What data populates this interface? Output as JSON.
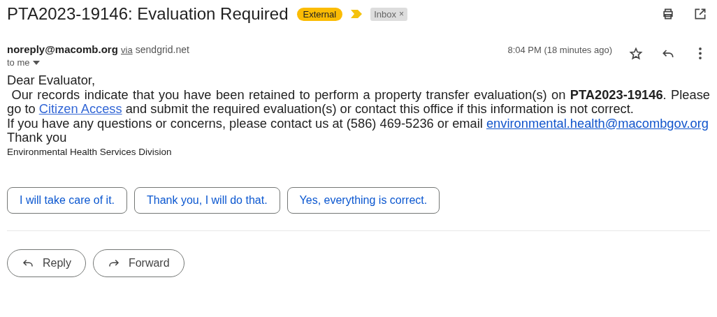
{
  "subject": "PTA2023-19146: Evaluation Required",
  "labels": [
    {
      "kind": "external",
      "text": "External"
    },
    {
      "kind": "importance"
    },
    {
      "kind": "inbox",
      "text": "Inbox",
      "close": "×"
    }
  ],
  "sender": {
    "address": "noreply@macomb.org",
    "via": "via",
    "relay": "sendgrid.net",
    "recipient": "to me"
  },
  "time": "8:04 PM (18 minutes ago)",
  "starred": false,
  "body": [
    {
      "kind": "plain",
      "text": "Dear Evaluator,"
    },
    {
      "kind": "paragraph",
      "before": " Our records indicate that you have been retained to perform a property transfer evaluation(s) on **PTA2023-19146**. Please go to ",
      "link": "Citizen Access",
      "after": " and submit the required evaluation(s) or contact this office if this information is not correct."
    },
    {
      "kind": "paragraph",
      "before": "If you have any questions or concerns, please contact us at (586) 469-5236 or email ",
      "link": "environmental.health@macombgov.org"
    },
    {
      "kind": "plain",
      "text": "Thank you"
    },
    {
      "kind": "small",
      "text": "Environmental Health Services Division"
    }
  ],
  "smart_replies": [
    "I will take care of it.",
    "Thank you, I will do that.",
    "Yes, everything is correct."
  ],
  "actions": [
    {
      "kind": "reply",
      "label": "Reply"
    },
    {
      "kind": "forward",
      "label": "Forward"
    }
  ]
}
